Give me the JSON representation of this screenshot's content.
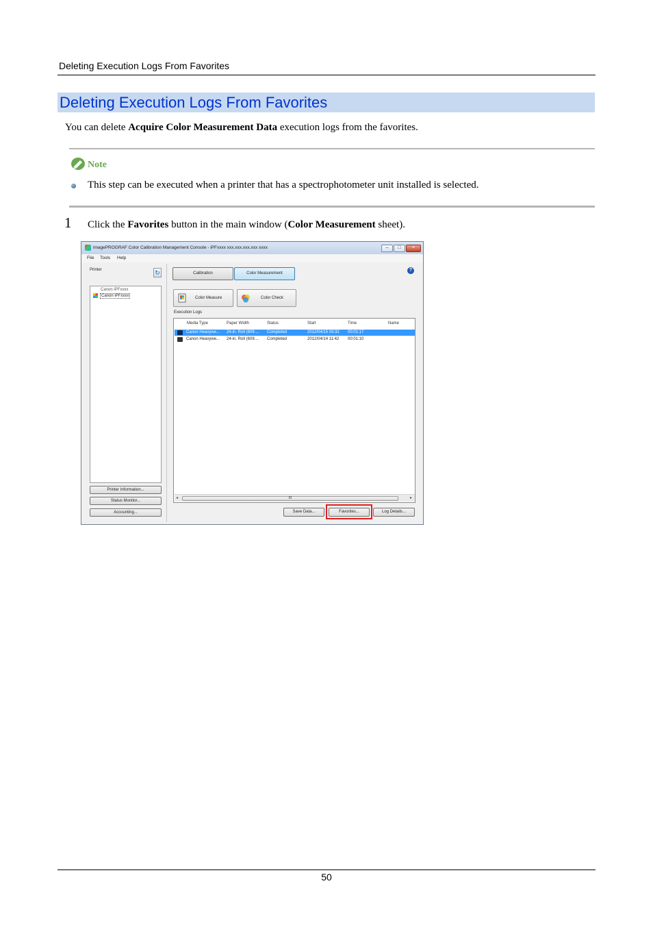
{
  "header": {
    "running_title": "Deleting Execution Logs From Favorites"
  },
  "section": {
    "title": "Deleting Execution Logs From Favorites"
  },
  "intro": {
    "pre": "You can delete ",
    "bold": "Acquire Color Measurement Data",
    "post": " execution logs from the favorites."
  },
  "note": {
    "label": "Note",
    "text": "This step can be executed when a printer that has a spectrophotometer unit installed is selected."
  },
  "step": {
    "number": "1",
    "pre": "Click the ",
    "bold1": "Favorites",
    "mid": " button in the main window (",
    "bold2": "Color Measurement",
    "post": " sheet)."
  },
  "app": {
    "title": "imagePROGRAF Color Calibration Management Console - iPFxxxx xxx.xxx.xxx.xxx xxxx",
    "menu": [
      "File",
      "Tools",
      "Help"
    ],
    "left": {
      "printer_label": "Printer",
      "tree_parent": "Canon iPFxxxx",
      "tree_child": "Canon iPFxxxx",
      "buttons": [
        "Printer Information...",
        "Status Monitor...",
        "Accounting..."
      ]
    },
    "tabs": [
      "Calibration",
      "Color Measurement"
    ],
    "tools": [
      "Color Measure",
      "Color Check"
    ],
    "logs_label": "Execution Logs",
    "columns": [
      "Media Type",
      "Paper Width",
      "Status",
      "Start",
      "Time",
      "Name"
    ],
    "rows": [
      [
        "Canon Heavywe...",
        "24-in. Roll (609....",
        "Completed",
        "2012/04/15 03:32",
        "00:01:17",
        ""
      ],
      [
        "Canon Heavywe...",
        "24-in. Roll (609....",
        "Completed",
        "2012/04/14 11:42",
        "00:01:10",
        ""
      ]
    ],
    "scroll_thumb": "III",
    "bottom_buttons": [
      "Save Data...",
      "Favorites...",
      "Log Details..."
    ]
  },
  "footer": {
    "page_number": "50"
  },
  "colors": {
    "title_band": "#c6d9f1",
    "title_text": "#0033cc",
    "note_green": "#6aa84f",
    "highlight": "#e0201f",
    "selection": "#3399ff"
  }
}
